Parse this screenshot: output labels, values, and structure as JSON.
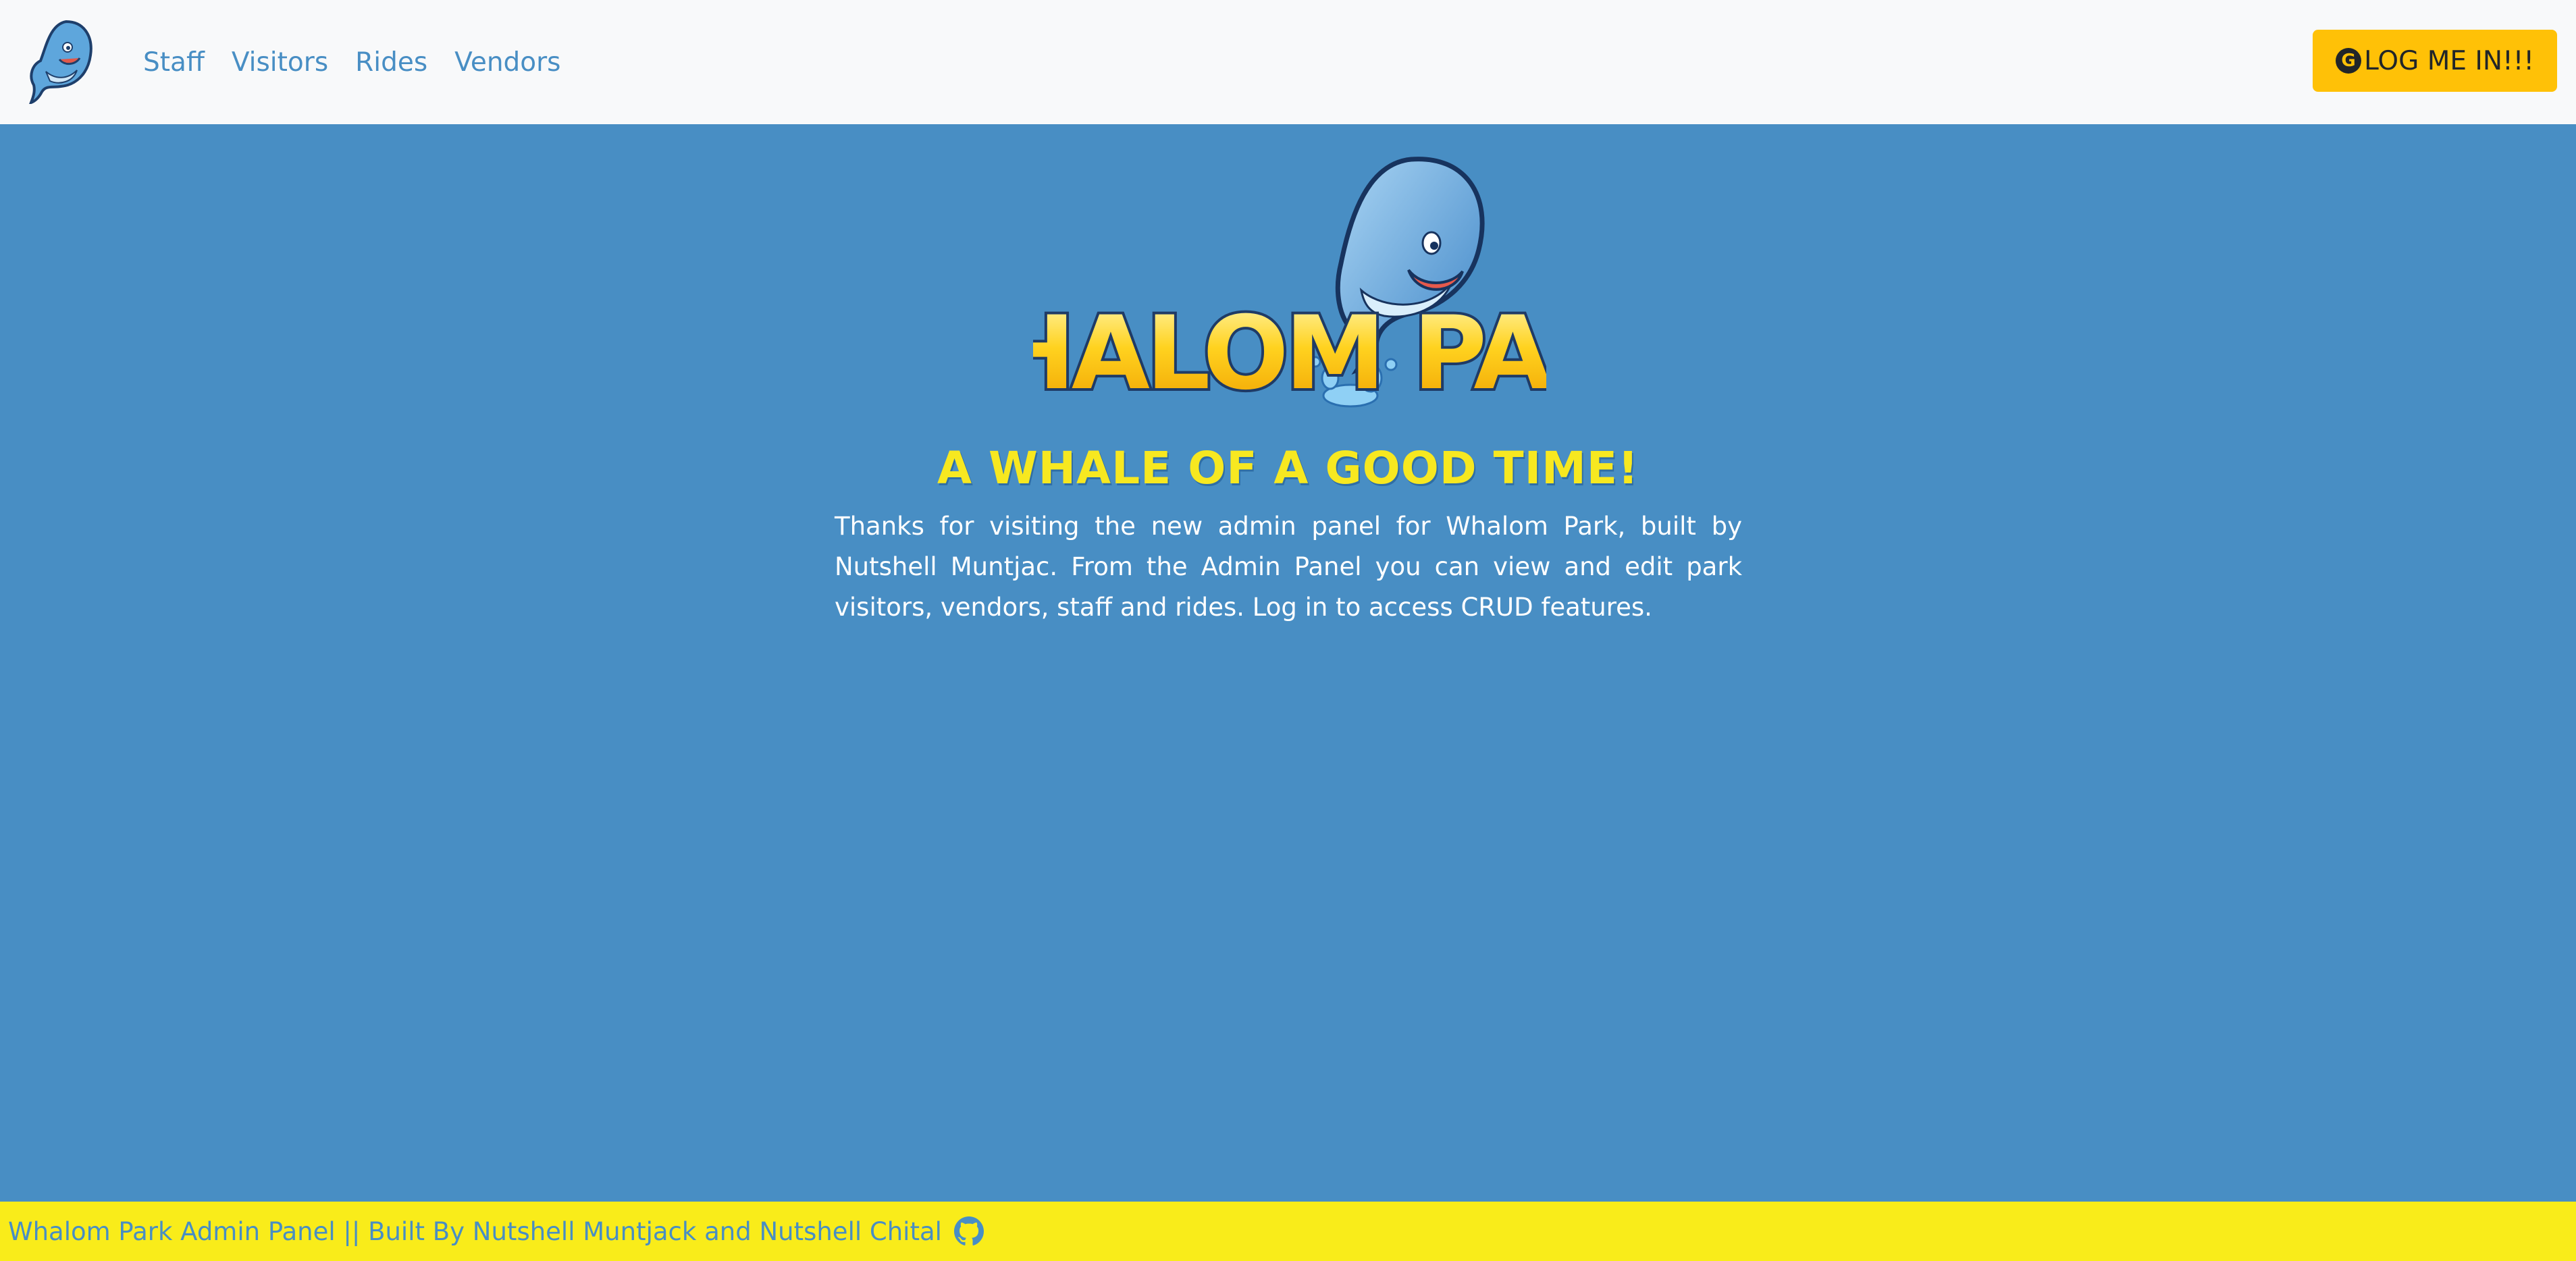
{
  "nav": {
    "items": [
      {
        "label": "Staff"
      },
      {
        "label": "Visitors"
      },
      {
        "label": "Rides"
      },
      {
        "label": "Vendors"
      }
    ],
    "login_label": "LOG ME IN!!!",
    "google_glyph": "G"
  },
  "hero": {
    "logo_text": "WHALOM PARK",
    "tagline": "A WHALE OF A GOOD TIME!",
    "intro": "Thanks for visiting the new admin panel for Whalom Park, built by Nutshell Muntjac. From the Admin Panel you can view and edit park visitors, vendors, staff and rides. Log in to access CRUD features."
  },
  "footer": {
    "text": "Whalom Park Admin Panel || Built By Nutshell Muntjack and Nutshell Chital"
  },
  "icons": {
    "nav_logo": "whale-icon",
    "login": "google-icon",
    "footer": "github-icon"
  },
  "colors": {
    "page_bg": "#488ec4",
    "navbar_bg": "#f8f9fa",
    "nav_link": "#488ec4",
    "login_button": "#ffc107",
    "tagline": "#f7e820",
    "footer_bg": "#f9ec1a",
    "footer_text": "#488ec4"
  }
}
